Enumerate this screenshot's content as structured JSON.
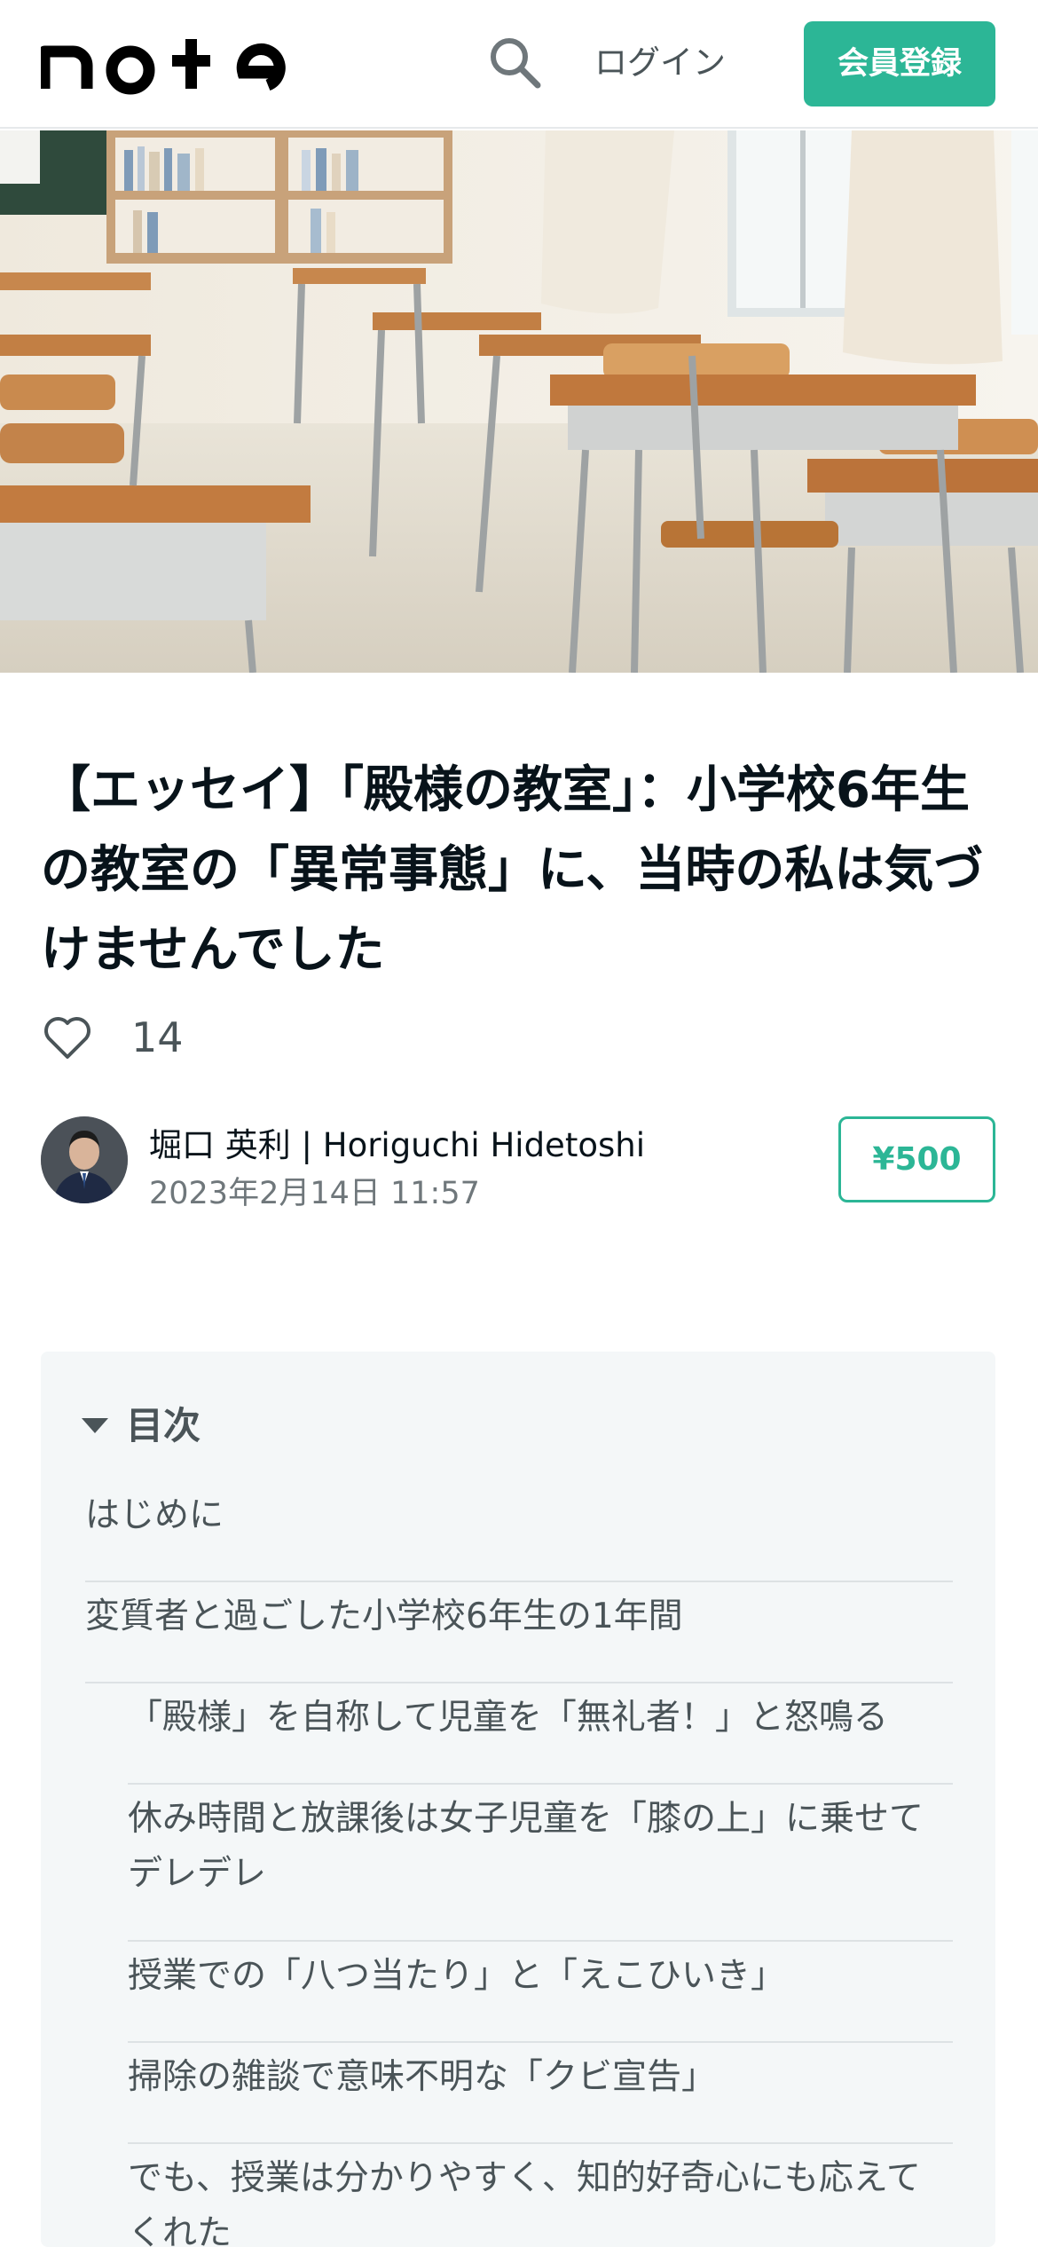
{
  "header": {
    "logo_text": "note",
    "search_icon": "search-icon",
    "login_label": "ログイン",
    "signup_label": "会員登録",
    "brand_color": "#2cb696"
  },
  "hero": {
    "image": "classroom-desks-photo"
  },
  "article": {
    "title": "【エッセイ】「殿様の教室」：小学校6年生の教室の「異常事態」に、当時の私は気づけませんでした",
    "like_icon": "heart-icon",
    "like_count": "14",
    "author": "堀口 英利 | Horiguchi Hidetoshi",
    "date": "2023年2月14日 11:57",
    "price": "¥500"
  },
  "toc": {
    "title": "目次",
    "items": [
      {
        "label": "はじめに"
      },
      {
        "label": "変質者と過ごした小学校6年生の1年間"
      },
      {
        "label": "「殿様」を自称して児童を「無礼者！」と怒鳴る"
      },
      {
        "label": "休み時間と放課後は女子児童を「膝の上」に乗せてデレデレ"
      },
      {
        "label": "授業での「八つ当たり」と「えこひいき」"
      },
      {
        "label": "掃除の雑談で意味不明な「クビ宣告」"
      },
      {
        "label": "でも、授業は分かりやすく、知的好奇心にも応えてくれた"
      }
    ]
  }
}
